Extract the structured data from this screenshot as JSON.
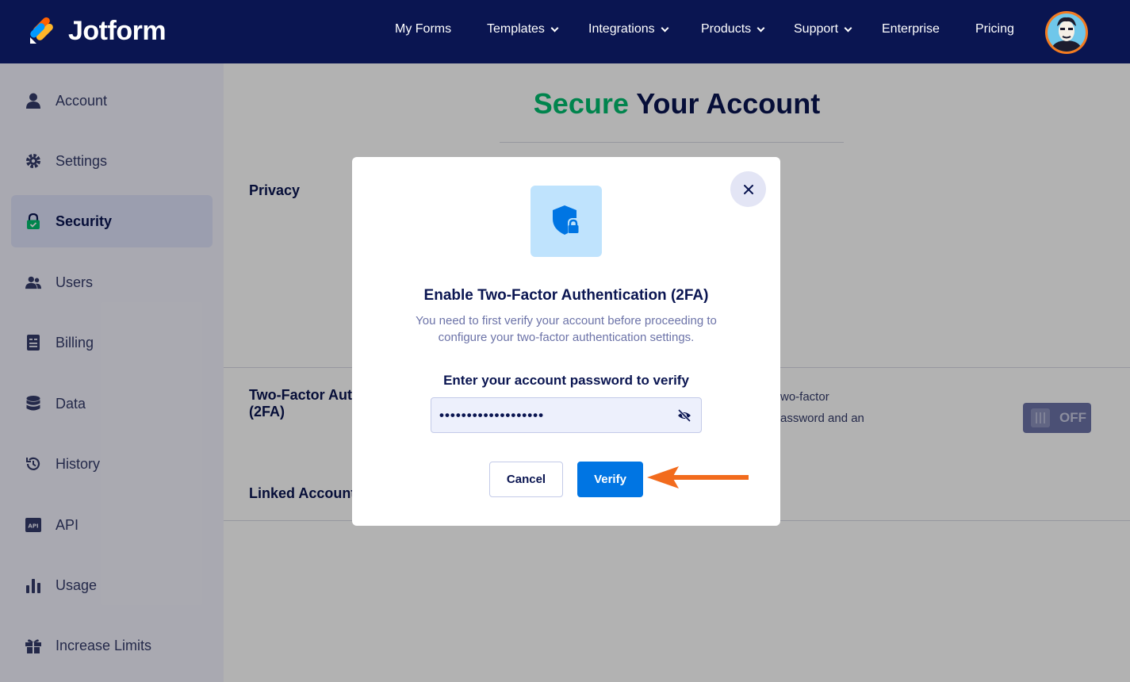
{
  "brand": {
    "name": "Jotform"
  },
  "nav": {
    "items": [
      {
        "label": "My Forms",
        "dropdown": false
      },
      {
        "label": "Templates",
        "dropdown": true
      },
      {
        "label": "Integrations",
        "dropdown": true
      },
      {
        "label": "Products",
        "dropdown": true
      },
      {
        "label": "Support",
        "dropdown": true
      },
      {
        "label": "Enterprise",
        "dropdown": false
      },
      {
        "label": "Pricing",
        "dropdown": false
      }
    ]
  },
  "sidebar": {
    "items": [
      {
        "label": "Account",
        "icon": "user-icon"
      },
      {
        "label": "Settings",
        "icon": "gear-icon"
      },
      {
        "label": "Security",
        "icon": "lock-icon",
        "active": true
      },
      {
        "label": "Users",
        "icon": "users-icon"
      },
      {
        "label": "Billing",
        "icon": "billing-icon"
      },
      {
        "label": "Data",
        "icon": "database-icon"
      },
      {
        "label": "History",
        "icon": "history-icon"
      },
      {
        "label": "API",
        "icon": "api-icon"
      },
      {
        "label": "Usage",
        "icon": "chart-icon"
      },
      {
        "label": "Increase Limits",
        "icon": "gift-icon"
      }
    ]
  },
  "main": {
    "title_highlight": "Secure",
    "title_rest": " Your Account",
    "sections": {
      "privacy": "Privacy",
      "two_factor_line1": "Two-Factor Aut",
      "two_factor_line2": "(2FA)",
      "two_factor_desc_line1": "wo-factor",
      "two_factor_desc_line2": "assword and an",
      "linked_accounts": "Linked Account"
    },
    "toggle": {
      "label": "OFF",
      "on": false
    }
  },
  "modal": {
    "title": "Enable Two-Factor Authentication (2FA)",
    "description": "You need to first verify your account before proceeding to configure your two-factor authentication settings.",
    "password_label": "Enter your account password to verify",
    "password_value": "•••••••••••••••••••",
    "cancel_label": "Cancel",
    "verify_label": "Verify",
    "close_icon": "close-icon",
    "shield_icon": "shield-lock-icon"
  },
  "colors": {
    "nav_bg": "#0a1551",
    "accent_green": "#01bd6f",
    "primary_blue": "#0075e3",
    "arrow_orange": "#f26b1d"
  }
}
